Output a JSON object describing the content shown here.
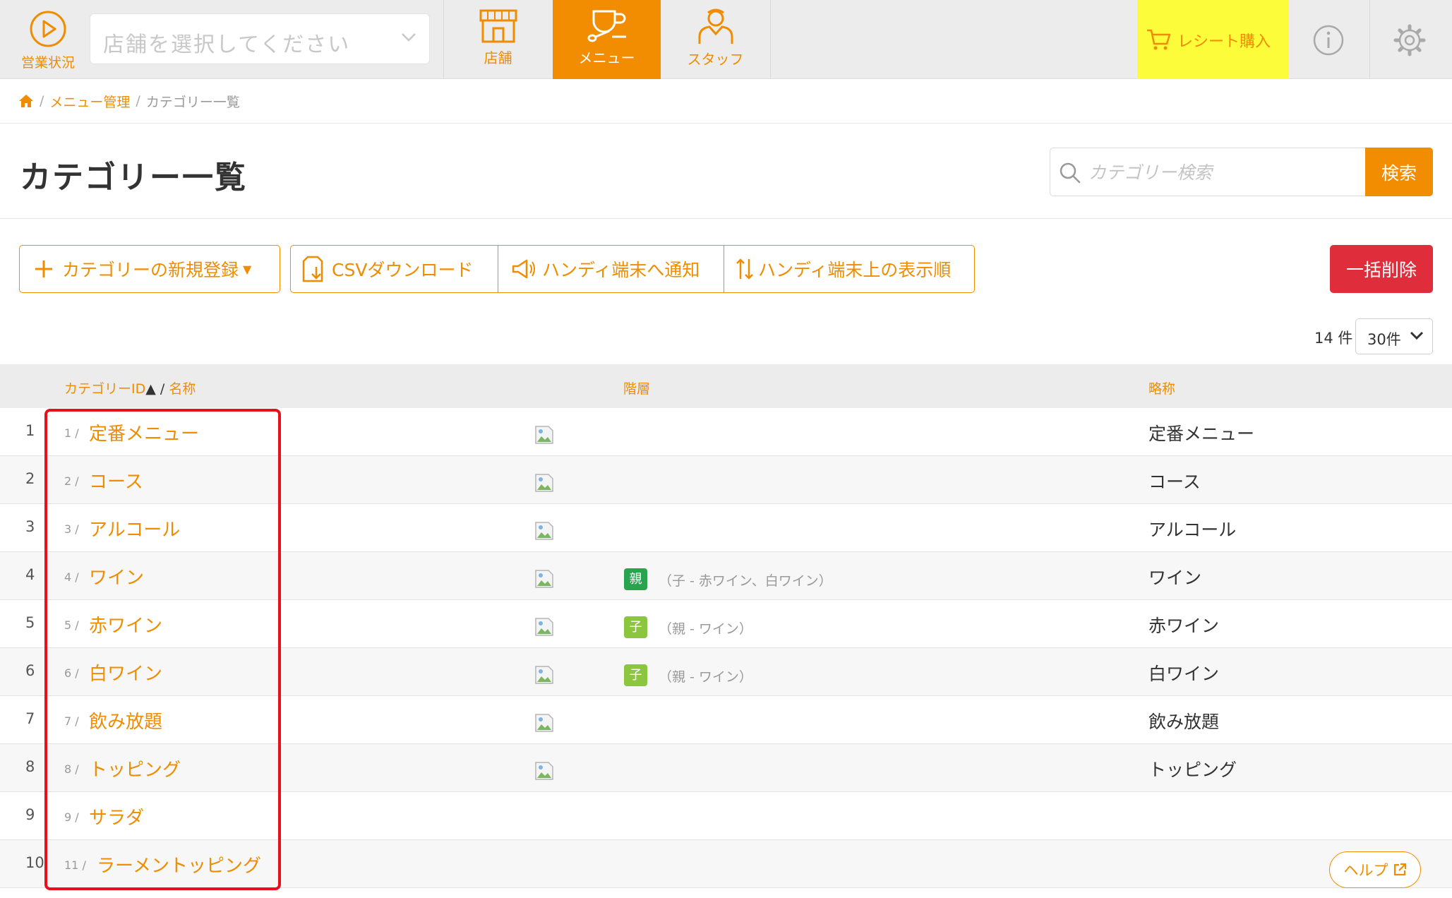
{
  "header": {
    "status_label": "営業状況",
    "store_placeholder": "店舗を選択してください",
    "tabs": [
      {
        "label": "店舗",
        "icon": "storefront-icon",
        "active": false
      },
      {
        "label": "メニュー",
        "icon": "menu-cup-icon",
        "active": true
      },
      {
        "label": "スタッフ",
        "icon": "staff-icon",
        "active": false
      }
    ],
    "receipt_label": "レシート購入",
    "info_icon": "info-icon",
    "settings_icon": "gear-icon"
  },
  "breadcrumb": {
    "sep": "/",
    "items": [
      "メニュー管理",
      "カテゴリー一覧"
    ]
  },
  "page": {
    "title": "カテゴリー一覧",
    "search_placeholder": "カテゴリー検索",
    "search_button": "検索"
  },
  "toolbar": {
    "add": "カテゴリーの新規登録",
    "csv": "CSVダウンロード",
    "notify": "ハンディ端末へ通知",
    "order": "ハンディ端末上の表示順",
    "bulk_delete": "一括削除"
  },
  "list": {
    "count": "14 件",
    "per_page": "30件"
  },
  "table": {
    "col_id": "カテゴリーID",
    "sort_mark": "▲",
    "slash": "/",
    "col_name": "名称",
    "col_level": "階層",
    "col_abbr": "略称",
    "rows": [
      {
        "no": "1",
        "id": "1 /",
        "name": "定番メニュー",
        "badge": "",
        "relation": "",
        "abbr": "定番メニュー"
      },
      {
        "no": "2",
        "id": "2 /",
        "name": "コース",
        "badge": "",
        "relation": "",
        "abbr": "コース"
      },
      {
        "no": "3",
        "id": "3 /",
        "name": "アルコール",
        "badge": "",
        "relation": "",
        "abbr": "アルコール"
      },
      {
        "no": "4",
        "id": "4 /",
        "name": "ワイン",
        "badge": "親",
        "relation": "（子 - 赤ワイン、白ワイン）",
        "abbr": "ワイン"
      },
      {
        "no": "5",
        "id": "5 /",
        "name": "赤ワイン",
        "badge": "子",
        "relation": "（親 - ワイン）",
        "abbr": "赤ワイン"
      },
      {
        "no": "6",
        "id": "6 /",
        "name": "白ワイン",
        "badge": "子",
        "relation": "（親 - ワイン）",
        "abbr": "白ワイン"
      },
      {
        "no": "7",
        "id": "7 /",
        "name": "飲み放題",
        "badge": "",
        "relation": "",
        "abbr": "飲み放題"
      },
      {
        "no": "8",
        "id": "8 /",
        "name": "トッピング",
        "badge": "",
        "relation": "",
        "abbr": "トッピング"
      },
      {
        "no": "9",
        "id": "9 /",
        "name": "サラダ",
        "badge": "",
        "relation": "",
        "abbr": ""
      },
      {
        "no": "10",
        "id": "11 /",
        "name": "ラーメントッピング",
        "badge": "",
        "relation": "",
        "abbr": ""
      }
    ]
  },
  "help_label": "ヘルプ",
  "colors": {
    "accent": "#f28c00",
    "danger": "#e02d3c",
    "highlight": "#fdfc3a",
    "badge_parent": "#2aa34f",
    "badge_child": "#8cc63f"
  }
}
